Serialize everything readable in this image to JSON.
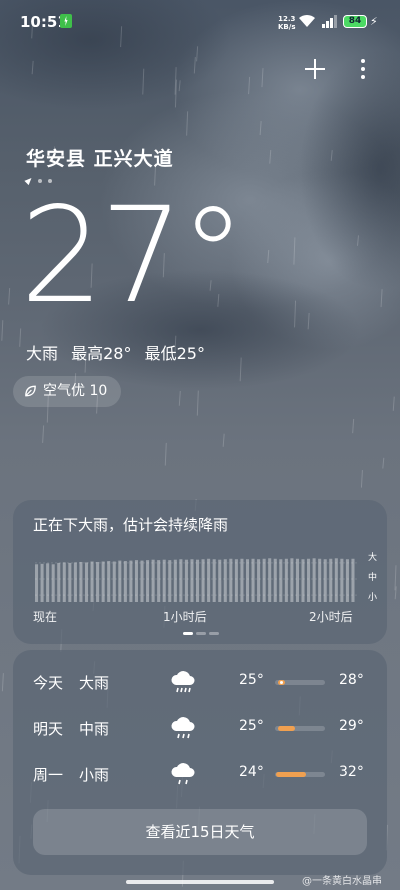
{
  "status_bar": {
    "time": "10:51",
    "net_speed_value": "12.3",
    "net_speed_unit": "KB/s",
    "battery": "84"
  },
  "location": {
    "name": "华安县 正兴大道"
  },
  "current": {
    "temperature": "27°",
    "condition": "大雨",
    "high": "最高28°",
    "low": "最低25°",
    "aqi": "空气优 10"
  },
  "precip_card": {
    "title": "正在下大雨，估计会持续降雨",
    "scale_labels": [
      "大",
      "中",
      "小"
    ],
    "x_labels": [
      "现在",
      "1小时后",
      "2小时后"
    ],
    "intensity_levels": [
      0.82,
      0.83,
      0.84,
      0.82,
      0.85,
      0.86,
      0.85,
      0.86,
      0.87,
      0.86,
      0.88,
      0.87,
      0.88,
      0.89,
      0.88,
      0.9,
      0.89,
      0.9,
      0.91,
      0.9,
      0.91,
      0.92,
      0.91,
      0.92,
      0.91,
      0.92,
      0.93,
      0.92,
      0.93,
      0.92,
      0.93,
      0.94,
      0.93,
      0.92,
      0.93,
      0.94,
      0.93,
      0.94,
      0.93,
      0.94,
      0.93,
      0.94,
      0.95,
      0.94,
      0.93,
      0.94,
      0.95,
      0.94,
      0.93,
      0.94,
      0.95,
      0.94,
      0.93,
      0.94,
      0.95,
      0.94,
      0.93,
      0.94
    ]
  },
  "forecast": {
    "rows": [
      {
        "day": "今天",
        "condition": "大雨",
        "icon": "heavy-rain-icon",
        "low": "25°",
        "high": "28°",
        "bar_start": 0.05,
        "bar_end": 0.2,
        "current_marker": 0.12
      },
      {
        "day": "明天",
        "condition": "中雨",
        "icon": "moderate-rain-icon",
        "low": "25°",
        "high": "29°",
        "bar_start": 0.05,
        "bar_end": 0.4
      },
      {
        "day": "周一",
        "condition": "小雨",
        "icon": "light-rain-icon",
        "low": "24°",
        "high": "32°",
        "bar_start": 0.02,
        "bar_end": 0.62
      }
    ],
    "button_label": "查看近15日天气"
  },
  "watermark": "@一条黄白水晶串",
  "colors": {
    "accent": "#f0a050",
    "card": "#5c6674"
  }
}
